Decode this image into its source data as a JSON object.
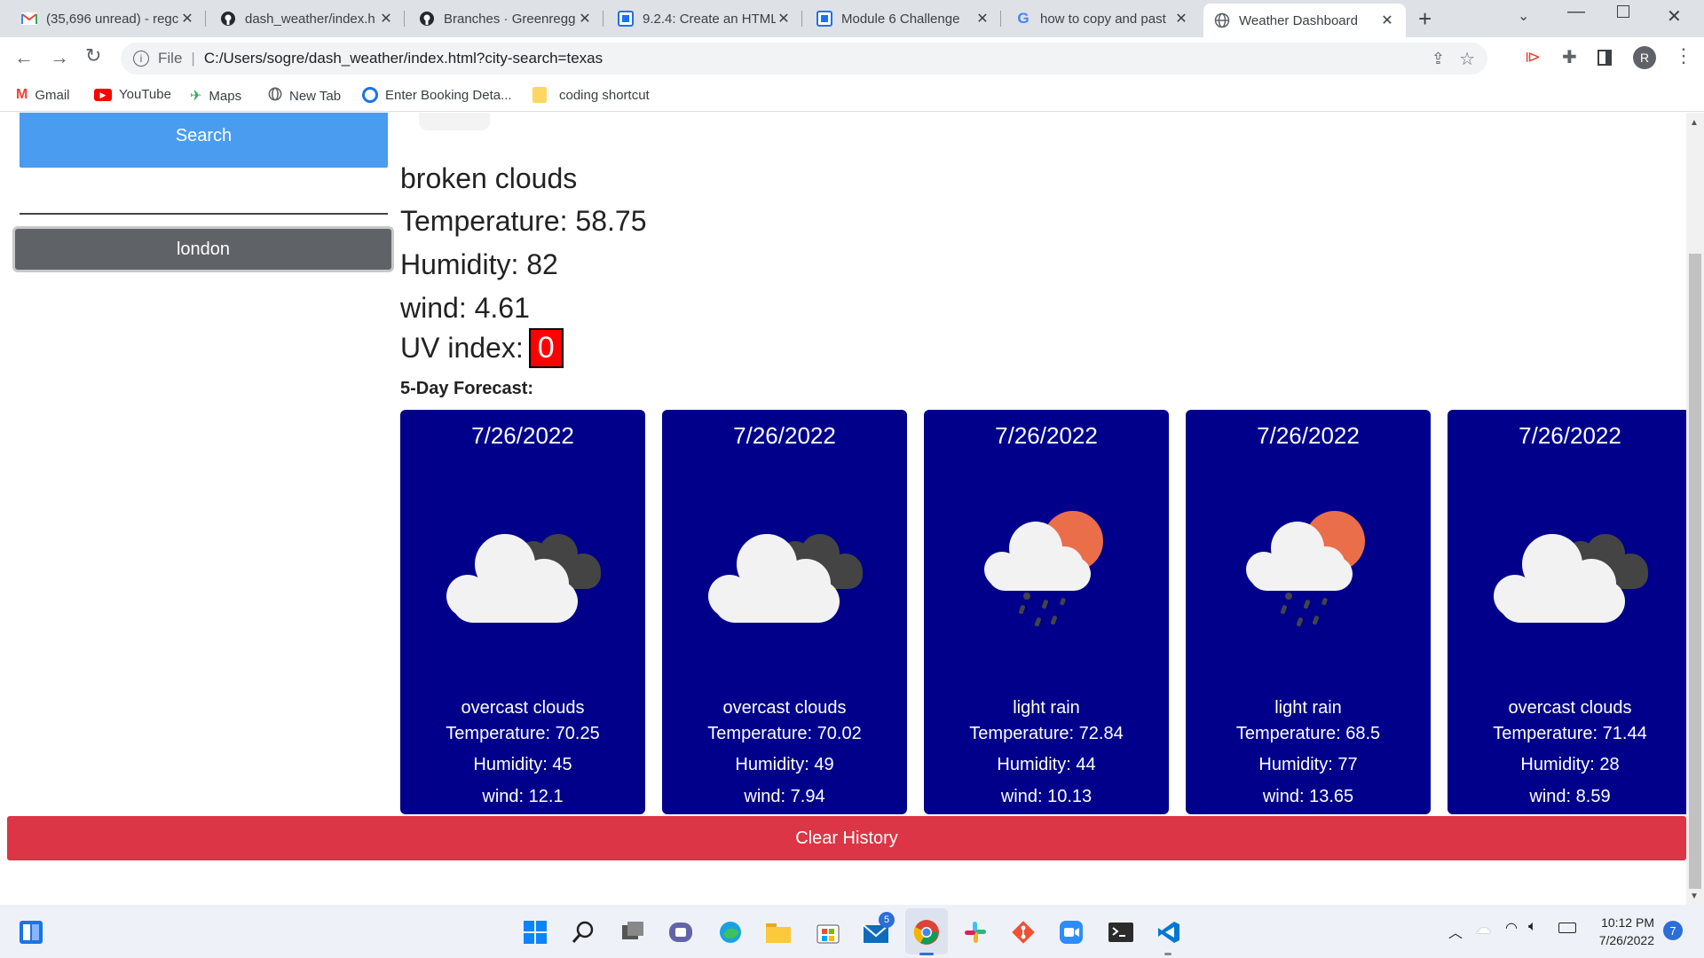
{
  "browser": {
    "tabs": [
      {
        "title": "(35,696 unread) - regc",
        "icon": "gmail-icon"
      },
      {
        "title": "dash_weather/index.h",
        "icon": "github-icon"
      },
      {
        "title": "Branches · Greenregg",
        "icon": "github-icon"
      },
      {
        "title": "9.2.4: Create an HTML",
        "icon": "canvas-icon"
      },
      {
        "title": "Module 6 Challenge",
        "icon": "canvas-icon"
      },
      {
        "title": "how to copy and past",
        "icon": "google-icon"
      },
      {
        "title": "Weather Dashboard",
        "icon": "globe-icon",
        "active": true
      }
    ],
    "address_scheme": "File",
    "address": "C:/Users/sogre/dash_weather/index.html?city-search=texas",
    "profile_initial": "R",
    "bookmarks": [
      "Gmail",
      "YouTube",
      "Maps",
      "New Tab",
      "Enter Booking Deta...",
      "coding shortcut"
    ]
  },
  "sidebar": {
    "search_label": "Search",
    "history": [
      "london"
    ]
  },
  "current": {
    "description": "broken clouds",
    "temperature_label": "Temperature: 58.75",
    "humidity_label": "Humidity: 82",
    "wind_label": "wind: 4.61",
    "uv_label": "UV index:",
    "uv_value": "0"
  },
  "forecast": {
    "title": "5-Day Forecast:",
    "cards": [
      {
        "date": "7/26/2022",
        "icon": "broken-clouds-icon",
        "desc": "overcast clouds",
        "temp": "Temperature: 70.25",
        "hum": "Humidity: 45",
        "wind": "wind: 12.1"
      },
      {
        "date": "7/26/2022",
        "icon": "broken-clouds-icon",
        "desc": "overcast clouds",
        "temp": "Temperature: 70.02",
        "hum": "Humidity: 49",
        "wind": "wind: 7.94"
      },
      {
        "date": "7/26/2022",
        "icon": "light-rain-icon",
        "desc": "light rain",
        "temp": "Temperature: 72.84",
        "hum": "Humidity: 44",
        "wind": "wind: 10.13"
      },
      {
        "date": "7/26/2022",
        "icon": "light-rain-icon",
        "desc": "light rain",
        "temp": "Temperature: 68.5",
        "hum": "Humidity: 77",
        "wind": "wind: 13.65"
      },
      {
        "date": "7/26/2022",
        "icon": "broken-clouds-icon",
        "desc": "overcast clouds",
        "temp": "Temperature: 71.44",
        "hum": "Humidity: 28",
        "wind": "wind: 8.59"
      }
    ]
  },
  "clear_label": "Clear History",
  "taskbar": {
    "time": "10:12 PM",
    "date": "7/26/2022",
    "notification_count": "7",
    "mail_badge": "5"
  },
  "colors": {
    "search_button": "#4a9cf0",
    "history_button": "#5f6368",
    "card_bg": "#00008b",
    "clear_button": "#dc3545",
    "uv_badge": "#ff0000"
  }
}
